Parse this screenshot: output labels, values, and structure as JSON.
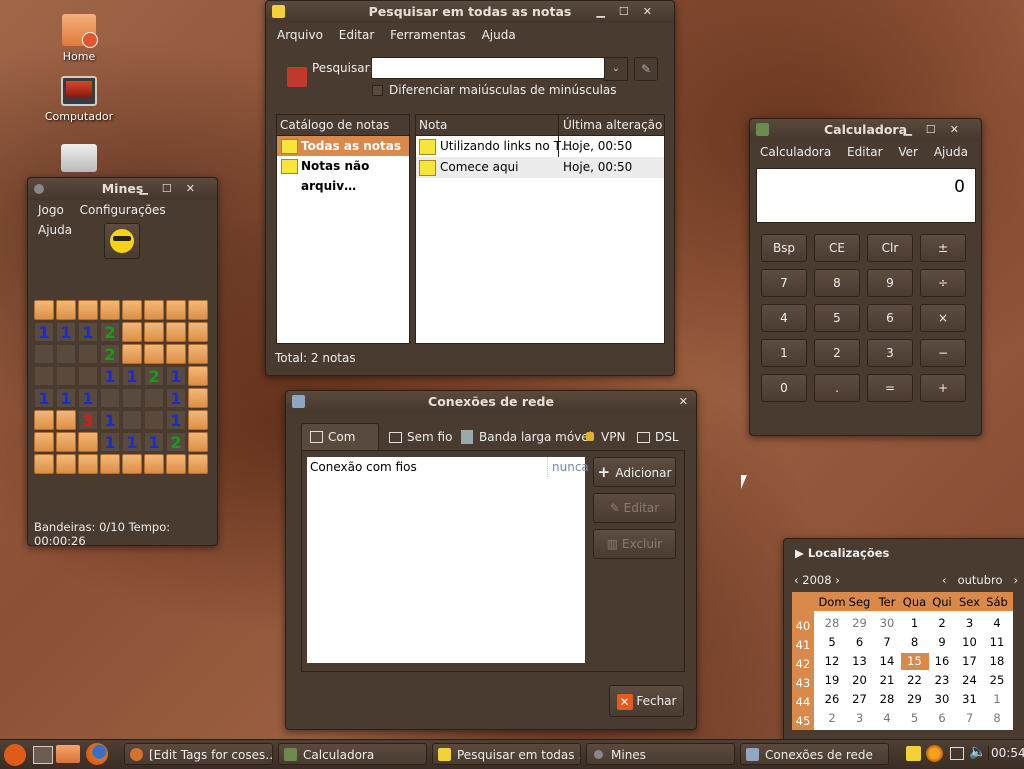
{
  "desktop": {
    "icons": [
      {
        "label": "Home",
        "icon": "home-folder-icon"
      },
      {
        "label": "Computador",
        "icon": "computer-icon"
      },
      {
        "label": "",
        "icon": "document-icon"
      }
    ]
  },
  "notes_search": {
    "title": "Pesquisar em todas as notas",
    "menu": [
      "Arquivo",
      "Editar",
      "Ferramentas",
      "Ajuda"
    ],
    "search_label": "Pesquisar:",
    "search_value": "",
    "case_sensitive_label": "Diferenciar maiúsculas de minúsculas",
    "catalog_header": "Catálogo de notas",
    "catalog_items": [
      "Todas as notas",
      "Notas não arquiv…"
    ],
    "columns": [
      "Nota",
      "Última alteração"
    ],
    "notes": [
      {
        "name": "Utilizando links no T…",
        "modified": "Hoje, 00:50"
      },
      {
        "name": "Comece aqui",
        "modified": "Hoje, 00:50"
      }
    ],
    "total": "Total: 2 notas"
  },
  "mines": {
    "title": "Mines",
    "menu": [
      "Jogo",
      "Configurações",
      "Ajuda"
    ],
    "status": "Bandeiras: 0/10 Tempo: 00:00:26",
    "grid": [
      [
        "c",
        "c",
        "c",
        "c",
        "c",
        "c",
        "c",
        "c"
      ],
      [
        "1",
        "1",
        "1",
        "2",
        "c",
        "c",
        "c",
        "c"
      ],
      [
        "o",
        "o",
        "o",
        "2",
        "c",
        "c",
        "c",
        "c"
      ],
      [
        "o",
        "o",
        "o",
        "1",
        "1",
        "2",
        "1",
        "c"
      ],
      [
        "1",
        "1",
        "1",
        "o",
        "o",
        "o",
        "1",
        "c"
      ],
      [
        "c",
        "c",
        "3",
        "1",
        "o",
        "o",
        "1",
        "c"
      ],
      [
        "c",
        "c",
        "c",
        "1",
        "1",
        "1",
        "2",
        "c"
      ],
      [
        "c",
        "c",
        "c",
        "c",
        "c",
        "c",
        "c",
        "c"
      ]
    ],
    "colors": {
      "1": "#1a2ad8",
      "2": "#1c9a1c",
      "3": "#e01818"
    }
  },
  "calculator": {
    "title": "Calculadora",
    "menu": [
      "Calculadora",
      "Editar",
      "Ver",
      "Ajuda"
    ],
    "display": "0",
    "buttons": [
      [
        "Bsp",
        "CE",
        "Clr",
        "±"
      ],
      [
        "7",
        "8",
        "9",
        "÷"
      ],
      [
        "4",
        "5",
        "6",
        "×"
      ],
      [
        "1",
        "2",
        "3",
        "−"
      ],
      [
        "0",
        ".",
        "=",
        "+"
      ]
    ]
  },
  "network": {
    "title": "Conexões de rede",
    "tabs": [
      "Com fios",
      "Sem fio",
      "Banda larga móvel",
      "VPN",
      "DSL"
    ],
    "connection": {
      "name": "Conexão com fios",
      "last_used": "nunca"
    },
    "buttons": {
      "add": "Adicionar",
      "edit": "Editar",
      "delete": "Excluir",
      "close": "Fechar"
    }
  },
  "calendar": {
    "header": "Localizações",
    "year": "2008",
    "month": "outubro",
    "weekdays": [
      "Dom",
      "Seg",
      "Ter",
      "Qua",
      "Qui",
      "Sex",
      "Sáb"
    ],
    "weeks": [
      {
        "num": "40",
        "days": [
          "28",
          "29",
          "30",
          "1",
          "2",
          "3",
          "4"
        ]
      },
      {
        "num": "41",
        "days": [
          "5",
          "6",
          "7",
          "8",
          "9",
          "10",
          "11"
        ]
      },
      {
        "num": "42",
        "days": [
          "12",
          "13",
          "14",
          "15",
          "16",
          "17",
          "18"
        ]
      },
      {
        "num": "43",
        "days": [
          "19",
          "20",
          "21",
          "22",
          "23",
          "24",
          "25"
        ]
      },
      {
        "num": "44",
        "days": [
          "26",
          "27",
          "28",
          "29",
          "30",
          "31",
          "1"
        ]
      },
      {
        "num": "45",
        "days": [
          "2",
          "3",
          "4",
          "5",
          "6",
          "7",
          "8"
        ]
      }
    ],
    "today": "15",
    "accent": "#d98a4a"
  },
  "taskbar": {
    "tasks": [
      "[Edit Tags for coses…",
      "Calculadora",
      "Pesquisar em todas …",
      "Mines",
      "Conexões de rede"
    ],
    "clock": "00:54"
  }
}
